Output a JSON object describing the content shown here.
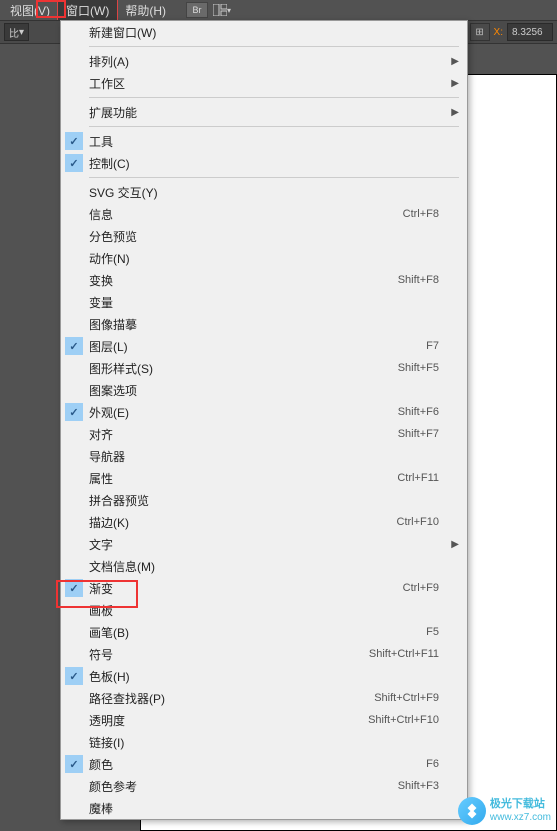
{
  "menubar": {
    "items": [
      "视图(V)",
      "窗口(W)",
      "帮助(H)"
    ],
    "br_label": "Br"
  },
  "toolbar2": {
    "left_label": "比",
    "x_label": "X:",
    "x_value": "8.3256"
  },
  "menu": {
    "groups": [
      [
        {
          "label": "新建窗口(W)",
          "check": false,
          "shortcut": "",
          "sub": false
        }
      ],
      [
        {
          "label": "排列(A)",
          "check": false,
          "shortcut": "",
          "sub": true
        },
        {
          "label": "工作区",
          "check": false,
          "shortcut": "",
          "sub": true
        }
      ],
      [
        {
          "label": "扩展功能",
          "check": false,
          "shortcut": "",
          "sub": true
        }
      ],
      [
        {
          "label": "工具",
          "check": true,
          "shortcut": "",
          "sub": false
        },
        {
          "label": "控制(C)",
          "check": true,
          "shortcut": "",
          "sub": false
        }
      ],
      [
        {
          "label": "SVG 交互(Y)",
          "check": false,
          "shortcut": "",
          "sub": false
        },
        {
          "label": "信息",
          "check": false,
          "shortcut": "Ctrl+F8",
          "sub": false
        },
        {
          "label": "分色预览",
          "check": false,
          "shortcut": "",
          "sub": false
        },
        {
          "label": "动作(N)",
          "check": false,
          "shortcut": "",
          "sub": false
        },
        {
          "label": "变换",
          "check": false,
          "shortcut": "Shift+F8",
          "sub": false
        },
        {
          "label": "变量",
          "check": false,
          "shortcut": "",
          "sub": false
        },
        {
          "label": "图像描摹",
          "check": false,
          "shortcut": "",
          "sub": false
        },
        {
          "label": "图层(L)",
          "check": true,
          "shortcut": "F7",
          "sub": false
        },
        {
          "label": "图形样式(S)",
          "check": false,
          "shortcut": "Shift+F5",
          "sub": false
        },
        {
          "label": "图案选项",
          "check": false,
          "shortcut": "",
          "sub": false
        },
        {
          "label": "外观(E)",
          "check": true,
          "shortcut": "Shift+F6",
          "sub": false
        },
        {
          "label": "对齐",
          "check": false,
          "shortcut": "Shift+F7",
          "sub": false
        },
        {
          "label": "导航器",
          "check": false,
          "shortcut": "",
          "sub": false
        },
        {
          "label": "属性",
          "check": false,
          "shortcut": "Ctrl+F11",
          "sub": false
        },
        {
          "label": "拼合器预览",
          "check": false,
          "shortcut": "",
          "sub": false
        },
        {
          "label": "描边(K)",
          "check": false,
          "shortcut": "Ctrl+F10",
          "sub": false
        },
        {
          "label": "文字",
          "check": false,
          "shortcut": "",
          "sub": true
        },
        {
          "label": "文档信息(M)",
          "check": false,
          "shortcut": "",
          "sub": false
        },
        {
          "label": "渐变",
          "check": true,
          "shortcut": "Ctrl+F9",
          "sub": false
        },
        {
          "label": "画板",
          "check": false,
          "shortcut": "",
          "sub": false
        },
        {
          "label": "画笔(B)",
          "check": false,
          "shortcut": "F5",
          "sub": false
        },
        {
          "label": "符号",
          "check": false,
          "shortcut": "Shift+Ctrl+F11",
          "sub": false
        },
        {
          "label": "色板(H)",
          "check": true,
          "shortcut": "",
          "sub": false
        },
        {
          "label": "路径查找器(P)",
          "check": false,
          "shortcut": "Shift+Ctrl+F9",
          "sub": false
        },
        {
          "label": "透明度",
          "check": false,
          "shortcut": "Shift+Ctrl+F10",
          "sub": false
        },
        {
          "label": "链接(I)",
          "check": false,
          "shortcut": "",
          "sub": false
        },
        {
          "label": "颜色",
          "check": true,
          "shortcut": "F6",
          "sub": false
        },
        {
          "label": "颜色参考",
          "check": false,
          "shortcut": "Shift+F3",
          "sub": false
        },
        {
          "label": "魔棒",
          "check": false,
          "shortcut": "",
          "sub": false
        }
      ]
    ]
  },
  "watermark": {
    "line1": "极光下载站",
    "line2": "www.xz7.com"
  }
}
